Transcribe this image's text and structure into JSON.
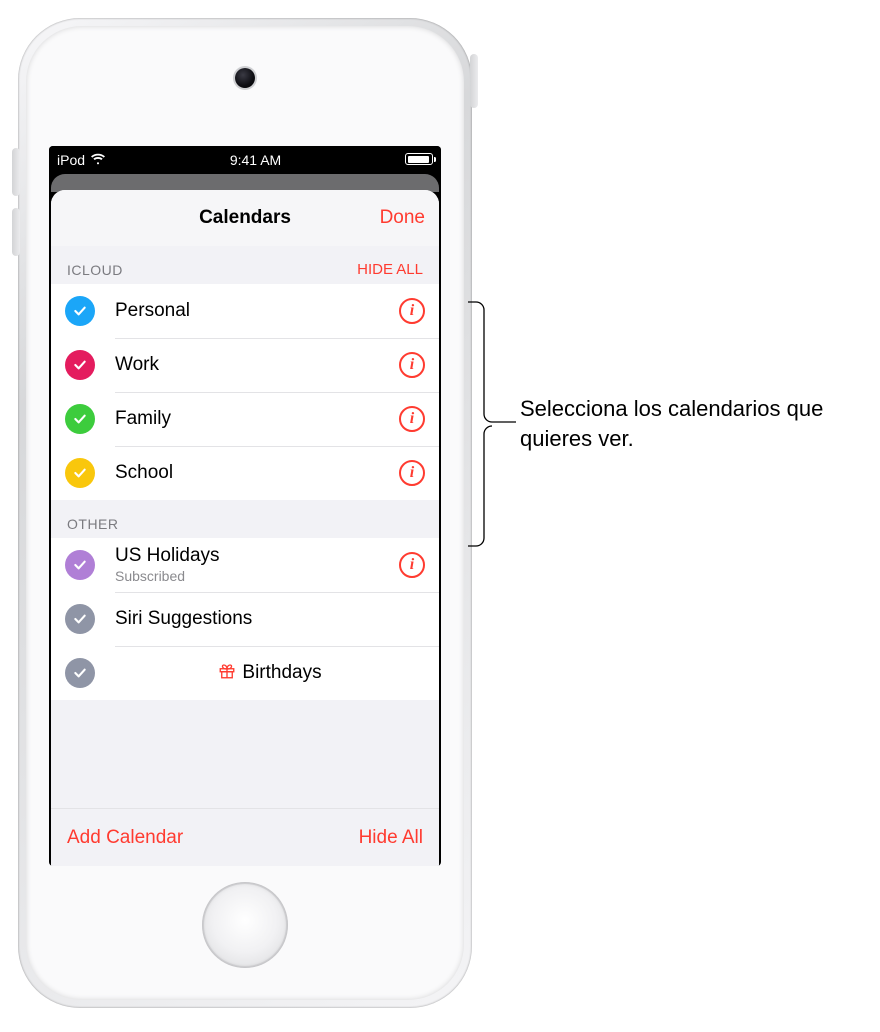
{
  "statusbar": {
    "device": "iPod",
    "time": "9:41 AM"
  },
  "sheet": {
    "title": "Calendars",
    "done": "Done"
  },
  "sections": {
    "icloud": {
      "header": "ICLOUD",
      "hide_all": "HIDE ALL",
      "items": [
        {
          "label": "Personal",
          "color": "#1BA6F8",
          "checked": true,
          "has_info": true
        },
        {
          "label": "Work",
          "color": "#E41C5E",
          "checked": true,
          "has_info": true
        },
        {
          "label": "Family",
          "color": "#3DCC3D",
          "checked": true,
          "has_info": true
        },
        {
          "label": "School",
          "color": "#F9C70C",
          "checked": true,
          "has_info": true
        }
      ]
    },
    "other": {
      "header": "OTHER",
      "items": [
        {
          "label": "US Holidays",
          "sub": "Subscribed",
          "color": "#B07FD6",
          "checked": true,
          "has_info": true,
          "muted": false
        },
        {
          "label": "Siri Suggestions",
          "color": "#8F95A6",
          "checked": true,
          "has_info": false,
          "muted": true
        },
        {
          "label": "Birthdays",
          "color": "#8F95A6",
          "checked": true,
          "has_info": false,
          "muted": true,
          "gift": true
        }
      ]
    }
  },
  "footer": {
    "add": "Add Calendar",
    "hide_all": "Hide All"
  },
  "callout": {
    "text": "Selecciona los calendarios que quieres ver."
  }
}
